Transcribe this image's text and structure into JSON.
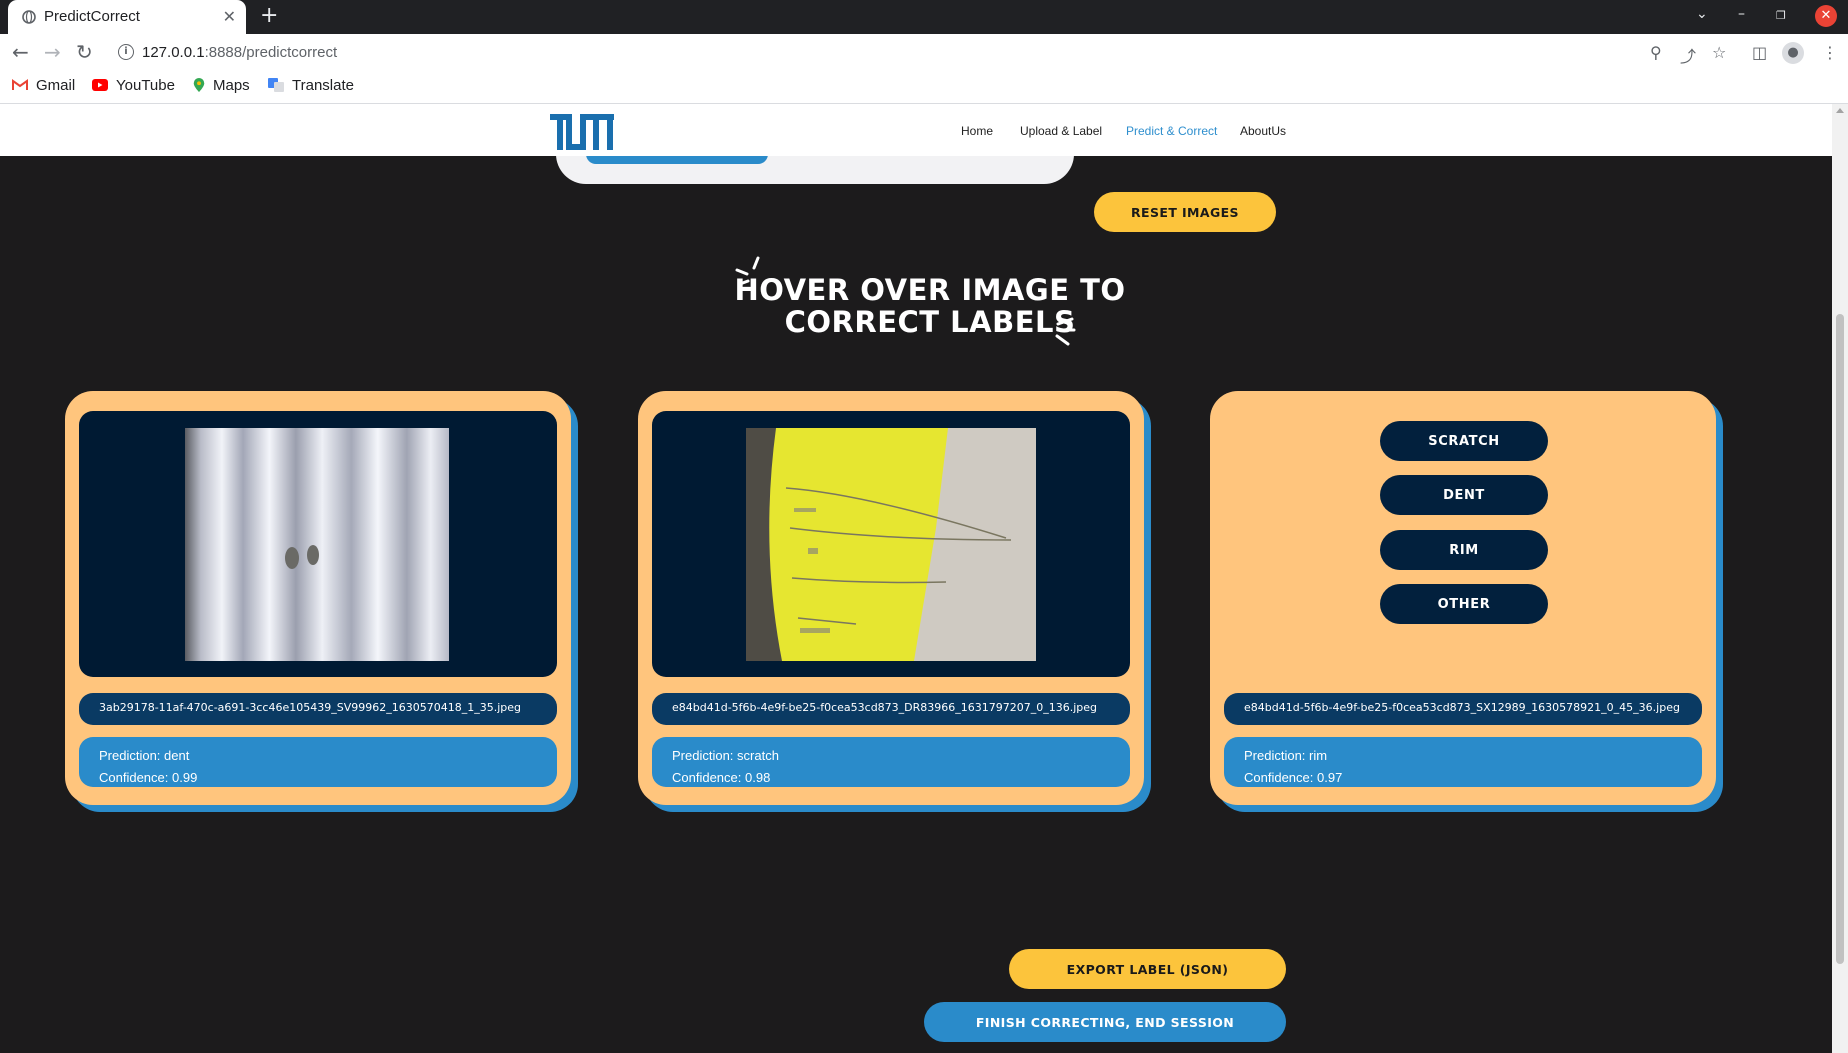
{
  "browser": {
    "tab_title": "PredictCorrect",
    "url_host": "127.0.0.1",
    "url_rest": ":8888/predictcorrect",
    "bookmarks": [
      "Gmail",
      "YouTube",
      "Maps",
      "Translate"
    ]
  },
  "nav": {
    "links": [
      "Home",
      "Upload & Label",
      "Predict & Correct",
      "AboutUs"
    ],
    "active": "Predict & Correct"
  },
  "buttons": {
    "reset": "RESET IMAGES",
    "export": "EXPORT LABEL (JSON)",
    "finish": "FINISH CORRECTING, END SESSION"
  },
  "heading": {
    "line1": "HOVER OVER IMAGE TO",
    "line2": "CORRECT LABELS"
  },
  "cards": [
    {
      "filename": "3ab29178-11af-470c-a691-3cc46e105439_SV99962_1630570418_1_35.jpeg",
      "prediction": "Prediction: dent",
      "confidence": "Confidence: 0.99"
    },
    {
      "filename": "e84bd41d-5f6b-4e9f-be25-f0cea53cd873_DR83966_1631797207_0_136.jpeg",
      "prediction": "Prediction: scratch",
      "confidence": "Confidence: 0.98"
    },
    {
      "filename": "e84bd41d-5f6b-4e9f-be25-f0cea53cd873_SX12989_1630578921_0_45_36.jpeg",
      "prediction": "Prediction: rim",
      "confidence": "Confidence: 0.97"
    }
  ],
  "label_options": [
    "SCRATCH",
    "DENT",
    "RIM",
    "OTHER"
  ],
  "colors": {
    "page_bg": "#1c1b1c",
    "card": "#ffc57d",
    "accent_blue": "#2a8bca",
    "accent_yellow": "#fcc43c",
    "navy": "#02203d"
  }
}
